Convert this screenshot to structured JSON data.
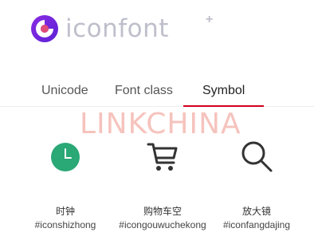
{
  "brand": {
    "name": "iconfont",
    "badge": "+",
    "mark_icon": "iconfont-logo-icon",
    "mark_colors": [
      "#7b2ff7",
      "#e04c7a",
      "#ffffff"
    ],
    "text_color": "#bfbfcc"
  },
  "tabs": [
    {
      "label": "Unicode",
      "active": false
    },
    {
      "label": "Font class",
      "active": false
    },
    {
      "label": "Symbol",
      "active": true
    }
  ],
  "accent_color": "#d0021b",
  "watermark": "LINKCHINA",
  "glyphs": [
    {
      "name": "时钟",
      "code": "#iconshizhong",
      "icon": "clock-icon",
      "color": "#2aa876"
    },
    {
      "name": "购物车空",
      "code": "#icongouwuchekong",
      "icon": "shopping-cart-icon",
      "color": "#333333"
    },
    {
      "name": "放大镜",
      "code": "#iconfangdajing",
      "icon": "magnifier-icon",
      "color": "#333333"
    }
  ]
}
